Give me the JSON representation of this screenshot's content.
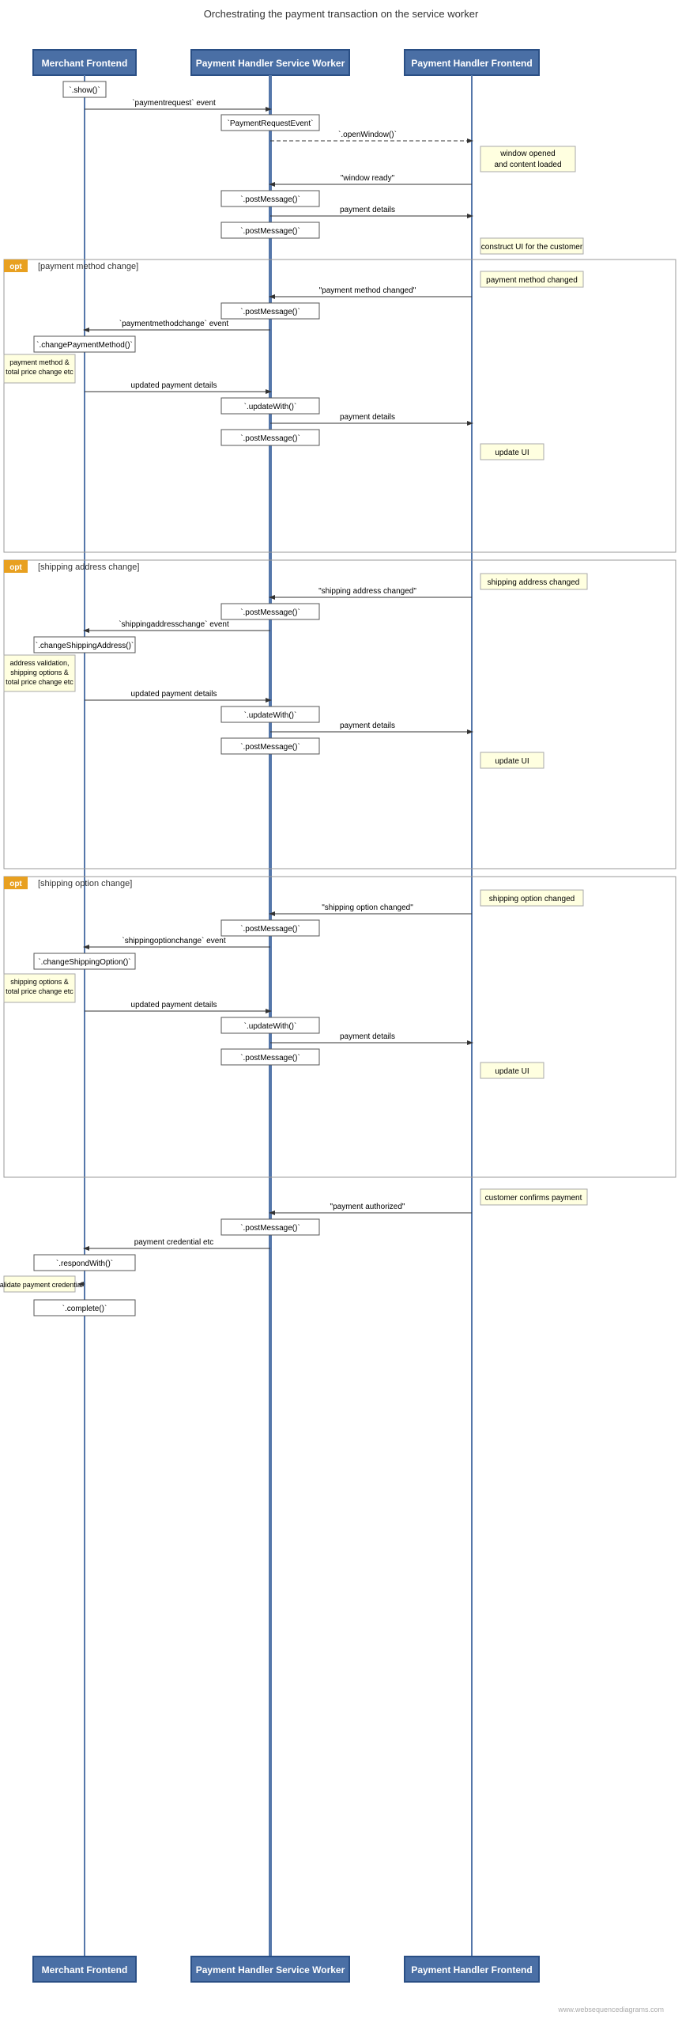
{
  "title": "Orchestrating the payment transaction on the service worker",
  "participants": [
    {
      "id": "merchant",
      "label": "Merchant Frontend"
    },
    {
      "id": "sw",
      "label": "Payment Handler Service Worker"
    },
    {
      "id": "frontend",
      "label": "Payment Handler Frontend"
    }
  ],
  "watermark": "www.websequencediagrams.com",
  "opt_labels": [
    {
      "id": "opt1",
      "label": "[payment method change]"
    },
    {
      "id": "opt2",
      "label": "[shipping address change]"
    },
    {
      "id": "opt3",
      "label": "[shipping option change]"
    }
  ],
  "messages": {
    "show": "`.show()`",
    "paymentrequest_event": "`paymentrequest` event",
    "PaymentRequestEvent": "`PaymentRequestEvent`",
    "openWindow": "`.openWindow()`",
    "window_opened": "window opened\nand content loaded",
    "window_ready": "\"window ready\"",
    "postMessage1": "`.postMessage()`",
    "payment_details1": "payment details",
    "postMessage2": "`.postMessage()`",
    "construct_ui": "construct UI for the customer",
    "payment_method_changed_note": "payment method changed",
    "payment_method_changed_msg": "\"payment method changed\"",
    "postMessage3": "`.postMessage()`",
    "paymentmethodchange_event": "`paymentmethodchange` event",
    "changePaymentMethod": "`.changePaymentMethod()`",
    "payment_method_total_note": "payment method &\ntotal price change etc",
    "updated_payment_details1": "updated payment details",
    "updateWith1": "`.updateWith()`",
    "payment_details2": "payment details",
    "postMessage4": "`.postMessage()`",
    "update_ui1": "update UI",
    "shipping_address_changed_note": "shipping address changed",
    "shipping_address_changed_msg": "\"shipping address changed\"",
    "postMessage5": "`.postMessage()`",
    "shippingaddresschange_event": "`shippingaddresschange` event",
    "changeShippingAddress": "`.changeShippingAddress()`",
    "address_validation_note": "address validation,\nshipping options &\ntotal price change etc",
    "updated_payment_details2": "updated payment details",
    "updateWith2": "`.updateWith()`",
    "payment_details3": "payment details",
    "postMessage6": "`.postMessage()`",
    "update_ui2": "update UI",
    "shipping_option_changed_note": "shipping option changed",
    "shipping_option_changed_msg": "\"shipping option changed\"",
    "postMessage7": "`.postMessage()`",
    "shippingoptionchange_event": "`shippingoptionchange` event",
    "changeShippingOption": "`.changeShippingOption()`",
    "shipping_options_note": "shipping options &\ntotal price change etc",
    "updated_payment_details3": "updated payment details",
    "updateWith3": "`.updateWith()`",
    "payment_details4": "payment details",
    "postMessage8": "`.postMessage()`",
    "update_ui3": "update UI",
    "customer_confirms": "customer confirms payment",
    "payment_authorized": "\"payment authorized\"",
    "postMessage9": "`.postMessage()`",
    "payment_credential_etc": "payment credential etc",
    "respondWith": "`.respondWith()`",
    "validate_payment": "validate payment credential",
    "complete": "`.complete()`"
  }
}
